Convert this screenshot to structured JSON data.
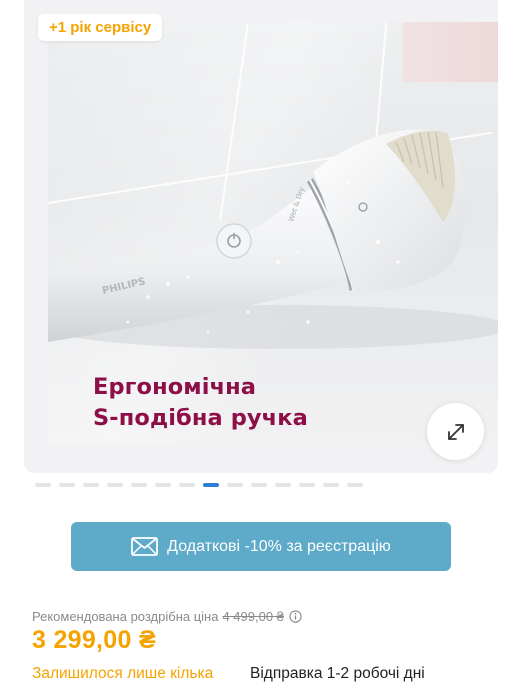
{
  "gallery": {
    "badge": "+1 рік сервісу",
    "caption_line1": "Ергономічна",
    "caption_line2": "S-подібна ручка",
    "product_brand_print": "PHILIPS",
    "product_side_print": "Wet & Dry",
    "slide_count": 14,
    "active_slide": 7,
    "icons": {
      "expand": "expand-arrows-icon",
      "power": "power-icon",
      "light": "light-icon"
    }
  },
  "promo": {
    "label": "Додаткові -10% за реєстрацію",
    "icon": "envelope-icon"
  },
  "pricing": {
    "rrp_label": "Рекомендована роздрібна ціна",
    "rrp_value": "4 499,00 ₴",
    "price": "3 299,00 ₴",
    "info_icon": "info-icon"
  },
  "availability": {
    "stock_text": "Залишилося лише кілька",
    "shipping_text": "Відправка 1-2 робочі дні"
  },
  "colors": {
    "accent_orange": "#f5a300",
    "caption_magenta": "#8d0f48",
    "promo_blue": "#5eaac9",
    "active_dot": "#2e7fd1"
  }
}
